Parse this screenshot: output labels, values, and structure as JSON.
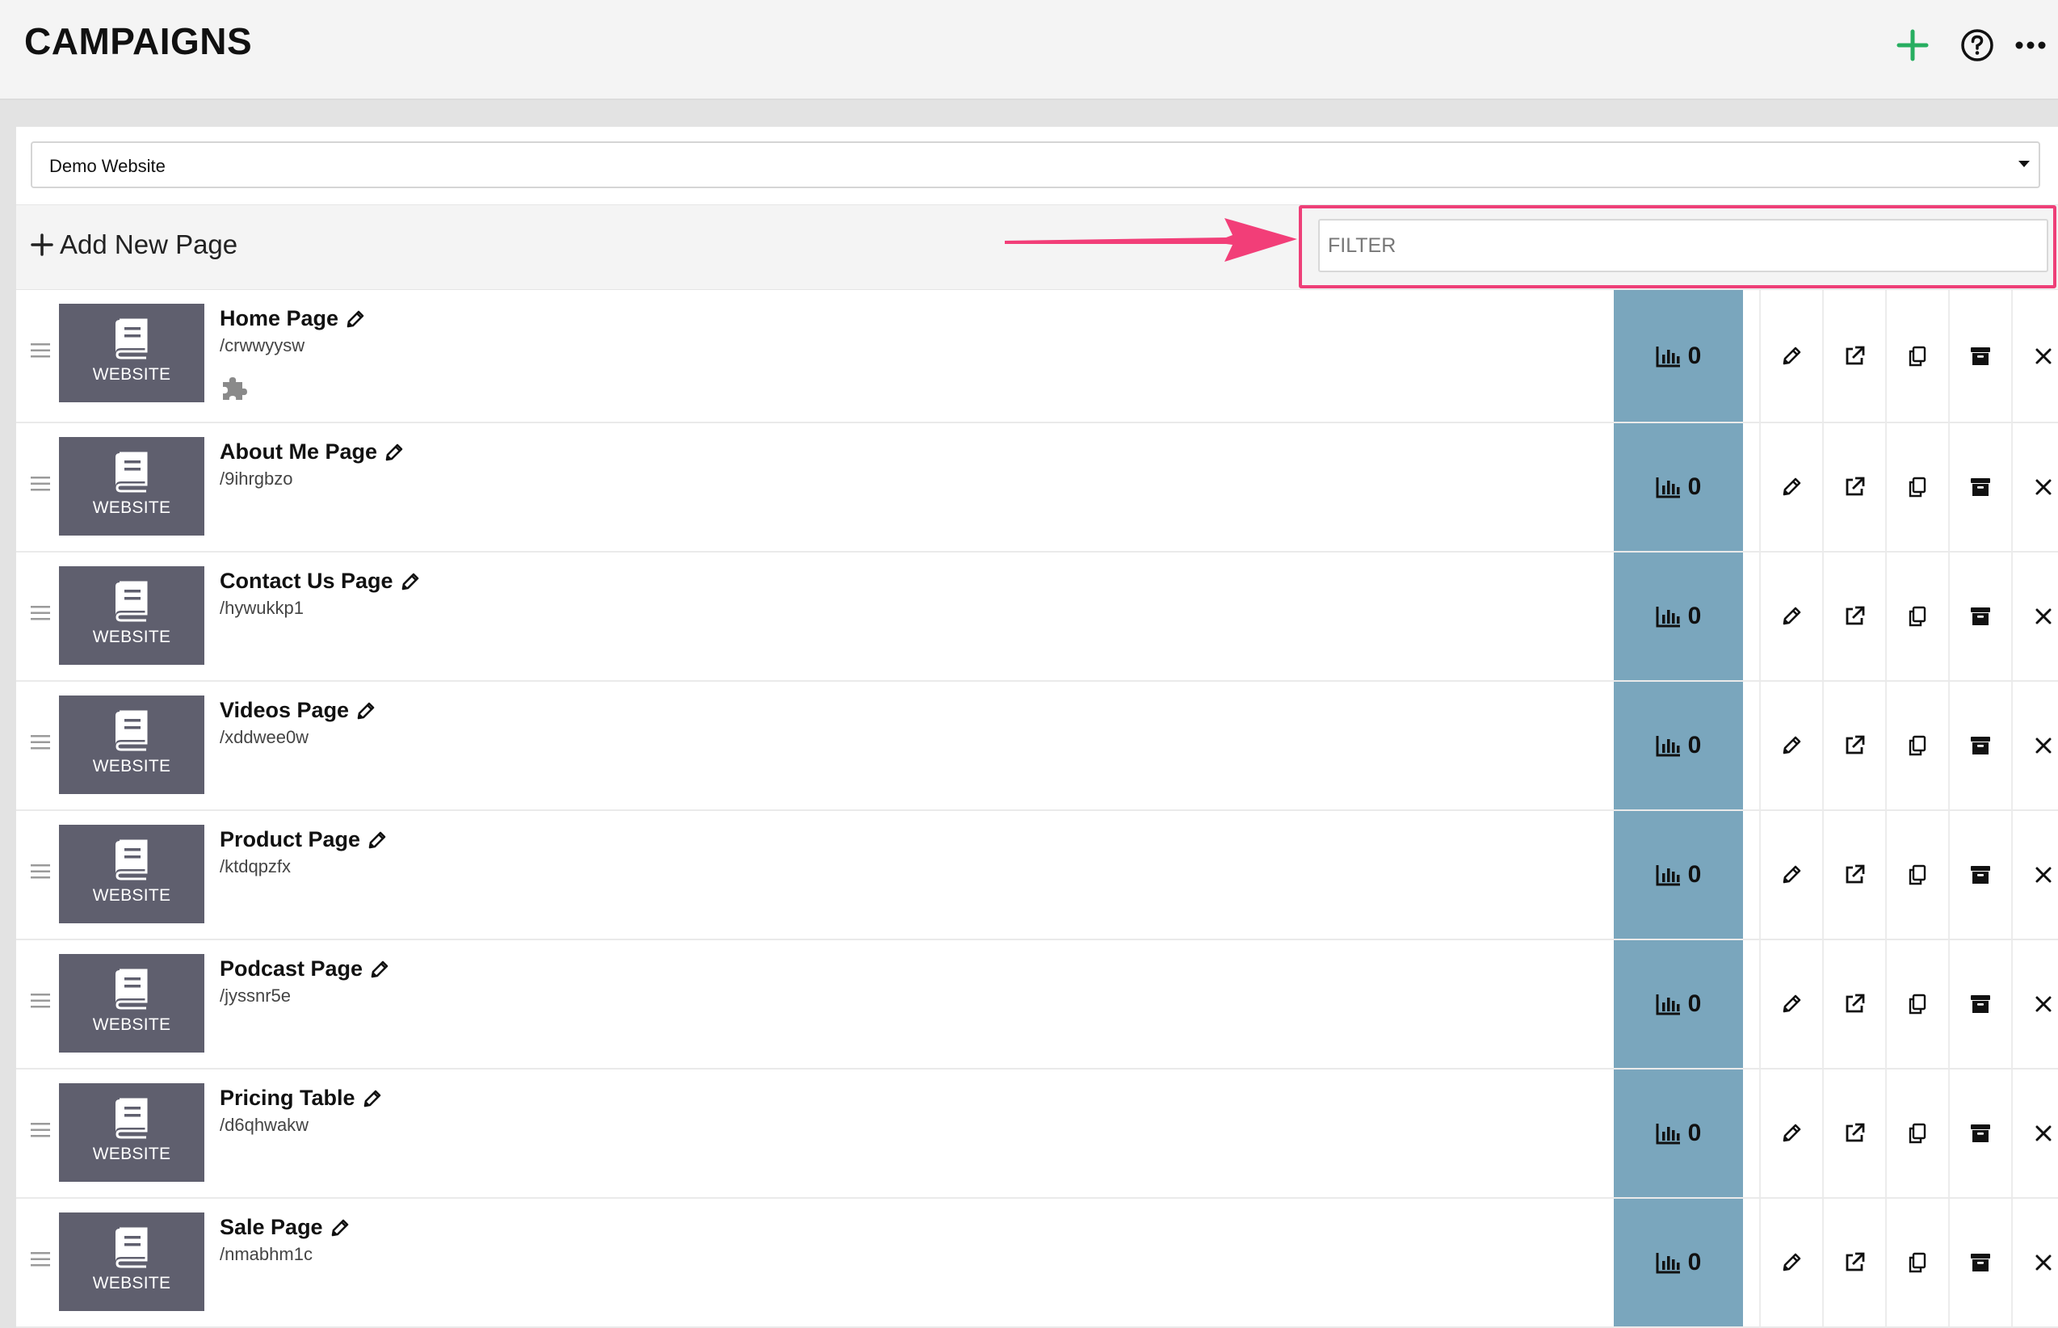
{
  "header": {
    "title": "CAMPAIGNS",
    "icons": {
      "add": "plus-icon",
      "help": "question-circle-icon",
      "more": "ellipsis-icon"
    },
    "accent_color": "#27ae60"
  },
  "site_select": {
    "value": "Demo Website"
  },
  "toolbar": {
    "add_new_label": "Add New Page",
    "filter_placeholder": "FILTER",
    "highlight_color": "#ee3f78"
  },
  "thumb_label": "WEBSITE",
  "pages": [
    {
      "name": "Home Page",
      "slug": "/crwwyysw",
      "stats": "0",
      "has_plugin": true
    },
    {
      "name": "About Me Page",
      "slug": "/9ihrgbzo",
      "stats": "0"
    },
    {
      "name": "Contact Us Page",
      "slug": "/hywukkp1",
      "stats": "0"
    },
    {
      "name": "Videos Page",
      "slug": "/xddwee0w",
      "stats": "0"
    },
    {
      "name": "Product Page",
      "slug": "/ktdqpzfx",
      "stats": "0"
    },
    {
      "name": "Podcast Page",
      "slug": "/jyssnr5e",
      "stats": "0"
    },
    {
      "name": "Pricing Table",
      "slug": "/d6qhwakw",
      "stats": "0"
    },
    {
      "name": "Sale Page",
      "slug": "/nmabhm1c",
      "stats": "0"
    }
  ],
  "row_actions": [
    "pencil-icon",
    "external-link-icon",
    "copy-icon",
    "archive-icon",
    "close-icon"
  ],
  "stats_color": "#7aa6bd"
}
